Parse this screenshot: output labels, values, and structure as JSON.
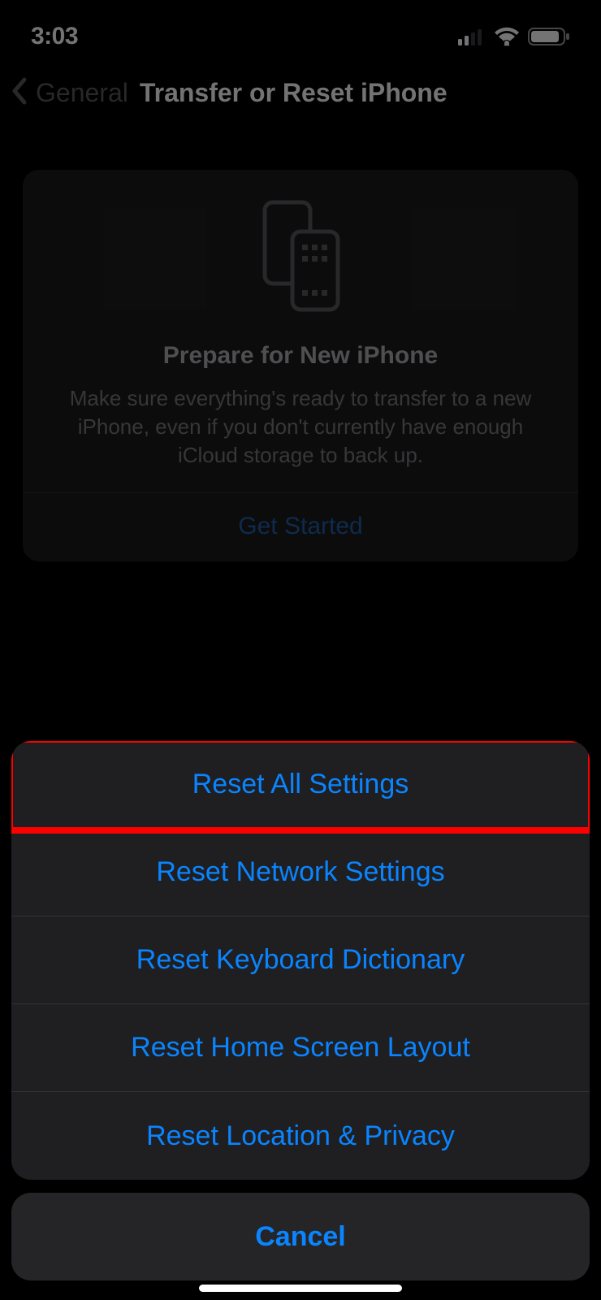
{
  "status_bar": {
    "time": "3:03"
  },
  "nav": {
    "back_label": "General",
    "title": "Transfer or Reset iPhone"
  },
  "prepare_card": {
    "title": "Prepare for New iPhone",
    "description": "Make sure everything's ready to transfer to a new iPhone, even if you don't currently have enough iCloud storage to back up.",
    "get_started": "Get Started"
  },
  "action_sheet": {
    "items": [
      {
        "label": "Reset All Settings"
      },
      {
        "label": "Reset Network Settings"
      },
      {
        "label": "Reset Keyboard Dictionary"
      },
      {
        "label": "Reset Home Screen Layout"
      },
      {
        "label": "Reset Location & Privacy"
      }
    ],
    "cancel": "Cancel"
  }
}
